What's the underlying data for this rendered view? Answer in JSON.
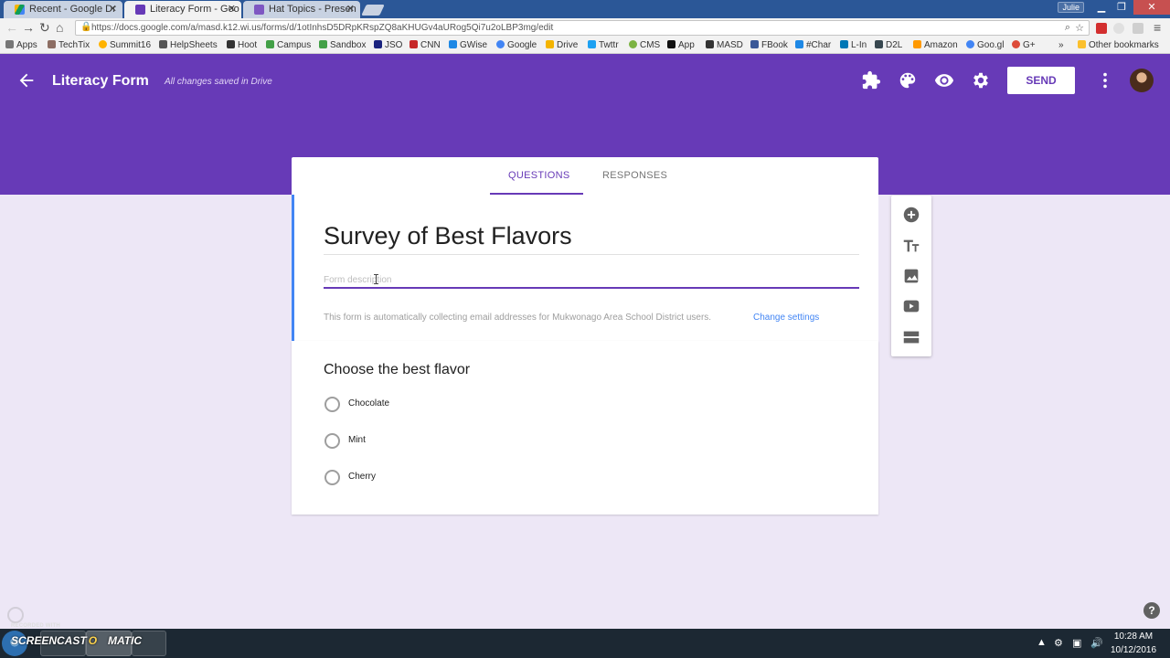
{
  "browser": {
    "tabs": [
      {
        "title": "Recent - Google Dr",
        "icon": "drive-icon"
      },
      {
        "title": "Literacy Form - Goo",
        "icon": "forms-icon"
      },
      {
        "title": "Hat Topics - Presen",
        "icon": "slides-icon"
      }
    ],
    "user": "Julie",
    "url": "https://docs.google.com/a/masd.k12.wi.us/forms/d/1otInhsD5DRpKRspZQ8aKHUGv4aURog5Qi7u2oLBP3mg/edit",
    "bookmarks": [
      "Apps",
      "TechTix",
      "Summit16",
      "HelpSheets",
      "Hoot",
      "Campus",
      "Sandbox",
      "JSO",
      "CNN",
      "GWise",
      "Google",
      "Drive",
      "Twttr",
      "CMS",
      "App",
      "MASD",
      "FBook",
      "#Char",
      "L-In",
      "D2L",
      "Amazon",
      "Goo.gl",
      "G+"
    ],
    "bookmarks_more": "»",
    "other_bookmarks": "Other bookmarks"
  },
  "header": {
    "title": "Literacy Form",
    "save_status": "All changes saved in Drive",
    "send_label": "SEND",
    "accent": "#673ab7"
  },
  "form_tabs": [
    {
      "label": "QUESTIONS",
      "active": true
    },
    {
      "label": "RESPONSES",
      "active": false
    }
  ],
  "form": {
    "title": "Survey of Best Flavors",
    "description_placeholder": "Form description",
    "email_note": "This form is automatically collecting email addresses for Mukwonago Area School District users.",
    "change_settings": "Change settings"
  },
  "question": {
    "title": "Choose the best flavor",
    "options": [
      "Chocolate",
      "Mint",
      "Cherry"
    ]
  },
  "side_toolbar": [
    "add-question-icon",
    "add-title-icon",
    "add-image-icon",
    "add-video-icon",
    "add-section-icon"
  ],
  "help": "?",
  "taskbar": {
    "recorded_with": "RECORDED WITH",
    "screencast_label": "SCREENCAST",
    "o_label": "O",
    "matic_label": "MATIC",
    "time": "10:28 AM",
    "date": "10/12/2016"
  }
}
